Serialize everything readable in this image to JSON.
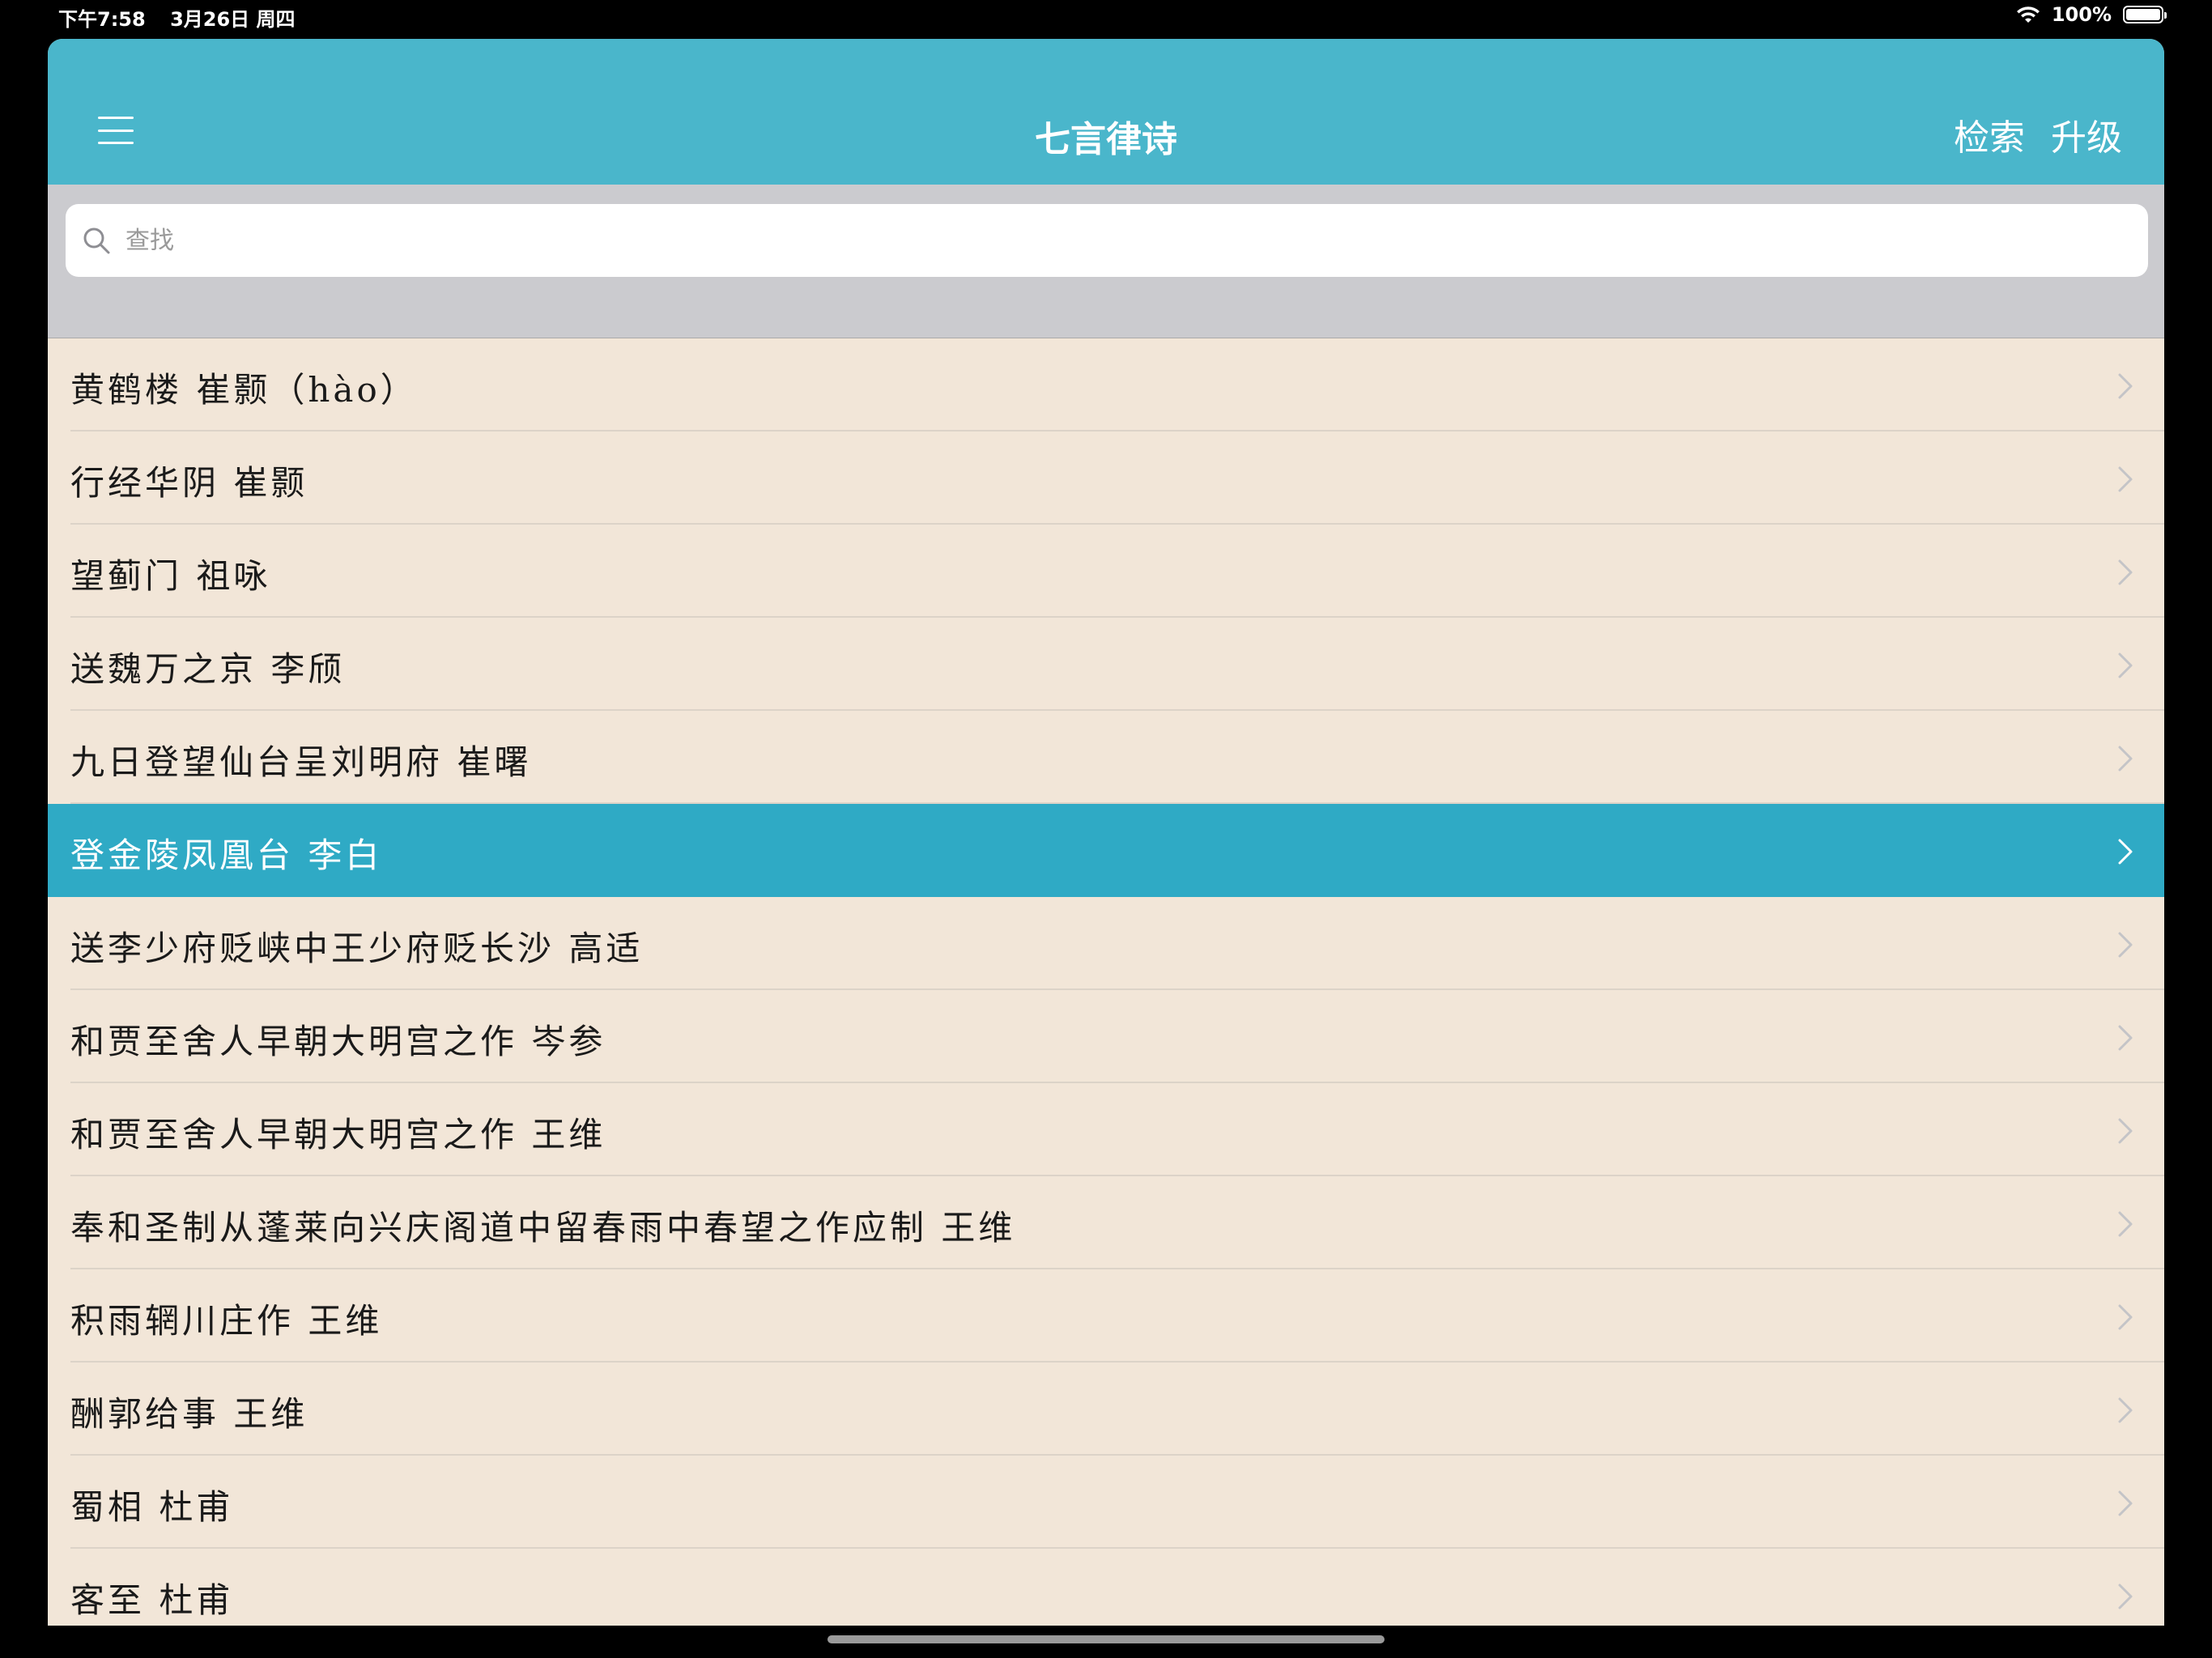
{
  "status_bar": {
    "time": "下午7:58",
    "date": "3月26日 周四",
    "battery": "100%"
  },
  "navbar": {
    "title": "七言律诗",
    "search_label": "检索",
    "upgrade_label": "升级"
  },
  "search": {
    "placeholder": "查找"
  },
  "list": {
    "selected_index": 5,
    "items": [
      {
        "label": "黄鹤楼 崔颢（hào）"
      },
      {
        "label": "行经华阴 崔颢"
      },
      {
        "label": "望蓟门 祖咏"
      },
      {
        "label": "送魏万之京 李颀"
      },
      {
        "label": "九日登望仙台呈刘明府 崔曙"
      },
      {
        "label": "登金陵凤凰台 李白"
      },
      {
        "label": "送李少府贬峡中王少府贬长沙 高适"
      },
      {
        "label": "和贾至舍人早朝大明宫之作 岑参"
      },
      {
        "label": "和贾至舍人早朝大明宫之作 王维"
      },
      {
        "label": "奉和圣制从蓬莱向兴庆阁道中留春雨中春望之作应制 王维"
      },
      {
        "label": "积雨辋川庄作 王维"
      },
      {
        "label": "酬郭给事 王维"
      },
      {
        "label": "蜀相 杜甫"
      },
      {
        "label": "客至 杜甫"
      }
    ]
  },
  "colors": {
    "navbar": "#4ab6cb",
    "selected_row": "#2faac5",
    "row_background": "#f2e6d8"
  }
}
